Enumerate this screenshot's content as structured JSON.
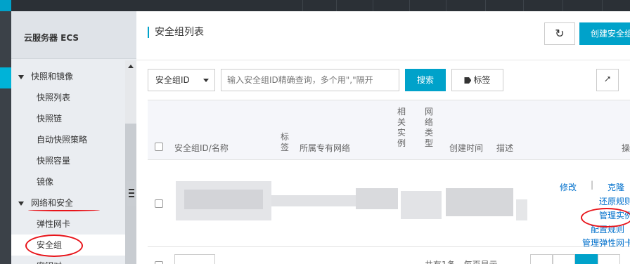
{
  "sidebar": {
    "header": "云服务器 ECS",
    "items": [
      {
        "label": "快照和镜像",
        "type": "group"
      },
      {
        "label": "快照列表",
        "type": "item"
      },
      {
        "label": "快照链",
        "type": "item"
      },
      {
        "label": "自动快照策略",
        "type": "item"
      },
      {
        "label": "快照容量",
        "type": "item"
      },
      {
        "label": "镜像",
        "type": "item"
      },
      {
        "label": "网络和安全",
        "type": "group"
      },
      {
        "label": "弹性网卡",
        "type": "item"
      },
      {
        "label": "安全组",
        "type": "item",
        "active": true
      },
      {
        "label": "密钥对",
        "type": "item"
      }
    ]
  },
  "main": {
    "title": "安全组列表",
    "create_button": "创建安全组",
    "refresh_icon": "refresh-icon",
    "filter_select": "安全组ID",
    "search_placeholder": "输入安全组ID精确查询，多个用\",\"隔开",
    "search_button": "搜索",
    "tag_button": "标签",
    "export_icon": "export-icon"
  },
  "table": {
    "headers": {
      "id_name": "安全组ID/名称",
      "tags": "标签",
      "vpc": "所属专有网络",
      "instances": "相关实例",
      "network_type": "网络类型",
      "created": "创建时间",
      "description": "描述",
      "actions": "操作"
    },
    "row_actions": {
      "modify": "修改",
      "sep": "|",
      "clone": "克隆",
      "restore_rules": "还原规则",
      "manage_instances": "管理实例",
      "configure_rules": "配置规则",
      "manage_eni": "管理弹性网卡"
    },
    "footer_text": "共有1条，每页显示"
  },
  "colors": {
    "accent": "#00a2ca",
    "annotation": "#e8141a",
    "link": "#0070cc"
  }
}
